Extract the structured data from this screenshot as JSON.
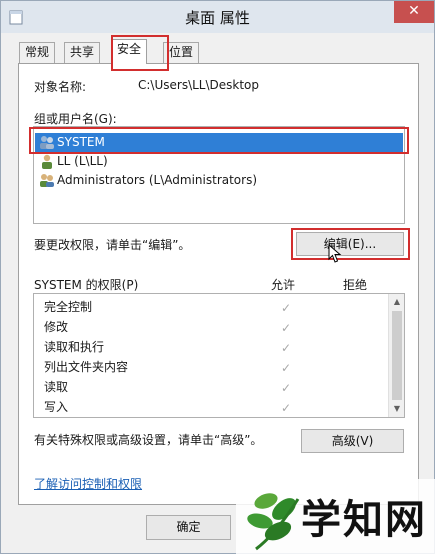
{
  "window": {
    "title": "桌面 属性",
    "close_glyph": "✕"
  },
  "tabs": [
    {
      "label": "常规"
    },
    {
      "label": "共享"
    },
    {
      "label": "安全",
      "active": true
    },
    {
      "label": "位置"
    }
  ],
  "security": {
    "object_label": "对象名称:",
    "object_value": "C:\\Users\\LL\\Desktop",
    "groups_label": "组或用户名(G):",
    "users": [
      {
        "name": "SYSTEM",
        "icon": "system-users-icon",
        "selected": true
      },
      {
        "name": "LL (L\\LL)",
        "icon": "user-icon",
        "selected": false
      },
      {
        "name": "Administrators (L\\Administrators)",
        "icon": "admin-users-icon",
        "selected": false
      }
    ],
    "edit_hint": "要更改权限，请单击“编辑”。",
    "edit_button": "编辑(E)...",
    "perm_title": "SYSTEM 的权限(P)",
    "allow_header": "允许",
    "deny_header": "拒绝",
    "permissions": [
      {
        "name": "完全控制",
        "allow": true
      },
      {
        "name": "修改",
        "allow": true
      },
      {
        "name": "读取和执行",
        "allow": true
      },
      {
        "name": "列出文件夹内容",
        "allow": true
      },
      {
        "name": "读取",
        "allow": true
      },
      {
        "name": "写入",
        "allow": true
      }
    ],
    "check_glyph": "✓",
    "advanced_hint": "有关特殊权限或高级设置，请单击“高级”。",
    "advanced_button": "高级(V)",
    "learn_link": "了解访问控制和权限"
  },
  "footer": {
    "ok_button": "确定"
  },
  "watermark": {
    "text": "学知网"
  },
  "colors": {
    "selection": "#2f7fd6",
    "highlight_box": "#d22e2e",
    "close": "#c7504f",
    "link": "#1a5fb4"
  }
}
